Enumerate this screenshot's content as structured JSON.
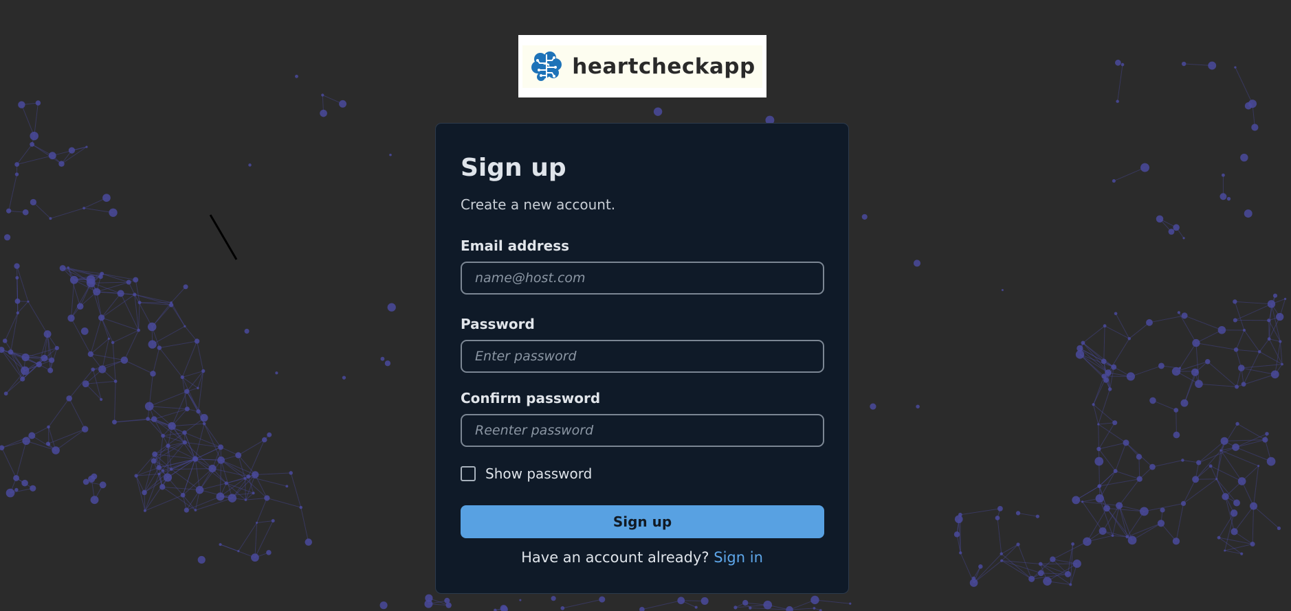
{
  "logo": {
    "text": "heartcheckapp",
    "icon": "brain-icon",
    "icon_color": "#1e73b8"
  },
  "form": {
    "title": "Sign up",
    "subtitle": "Create a new account.",
    "email": {
      "label": "Email address",
      "value": "",
      "placeholder": "name@host.com"
    },
    "password": {
      "label": "Password",
      "value": "",
      "placeholder": "Enter password"
    },
    "confirm_password": {
      "label": "Confirm password",
      "value": "",
      "placeholder": "Reenter password"
    },
    "show_password": {
      "label": "Show password",
      "checked": false
    },
    "submit_label": "Sign up",
    "footer": {
      "prompt": "Have an account already?",
      "link_label": "Sign in"
    }
  },
  "colors": {
    "page_background": "#2b2b2b",
    "card_background": "#0f1a28",
    "accent": "#58a1e2",
    "link": "#5ea7ea",
    "network_nodes": "#4a4a9c"
  }
}
